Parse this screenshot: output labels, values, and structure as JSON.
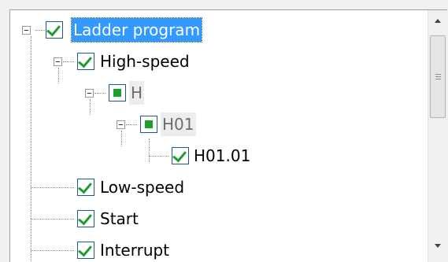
{
  "tree": {
    "nodes": [
      {
        "label": "Ladder program",
        "state": "checked",
        "expanded": true,
        "selected": true
      },
      {
        "label": "High-speed",
        "state": "checked",
        "expanded": true
      },
      {
        "label": "H",
        "state": "partial",
        "expanded": true
      },
      {
        "label": "H01",
        "state": "partial",
        "expanded": true
      },
      {
        "label": "H01.01",
        "state": "checked"
      },
      {
        "label": "Low-speed",
        "state": "checked"
      },
      {
        "label": "Start",
        "state": "checked"
      },
      {
        "label": "Interrupt",
        "state": "checked"
      }
    ]
  },
  "colors": {
    "selection": "#3399ff",
    "check": "#1aa02b",
    "checkbox_border": "#1c5a8a"
  },
  "icons": {
    "expander": "minus-box-icon",
    "checked": "checkmark-icon",
    "partial": "filled-square-icon",
    "scroll_up": "arrow-up-icon",
    "scroll_down": "arrow-down-icon"
  }
}
